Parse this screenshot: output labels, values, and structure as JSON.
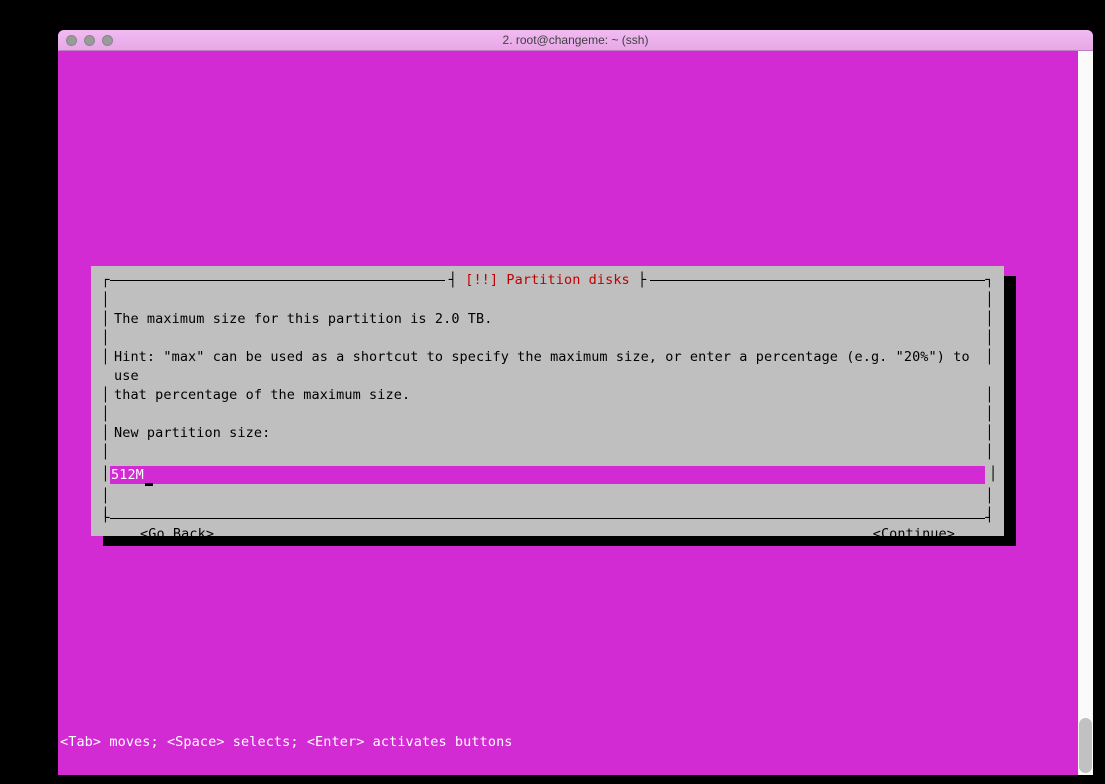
{
  "window": {
    "title": "2. root@changeme: ~ (ssh)"
  },
  "dialog": {
    "title_prefix": "[!!]",
    "title": "Partition disks",
    "max_size_line": "The maximum size for this partition is 2.0 TB.",
    "hint_line1": "Hint: \"max\" can be used as a shortcut to specify the maximum size, or enter a percentage (e.g. \"20%\") to use",
    "hint_line2": "that percentage of the maximum size.",
    "prompt": "New partition size:",
    "input_value": "512M",
    "go_back": "<Go Back>",
    "continue": "<Continue>"
  },
  "statusbar": {
    "text": "<Tab> moves; <Space> selects; <Enter> activates buttons"
  }
}
